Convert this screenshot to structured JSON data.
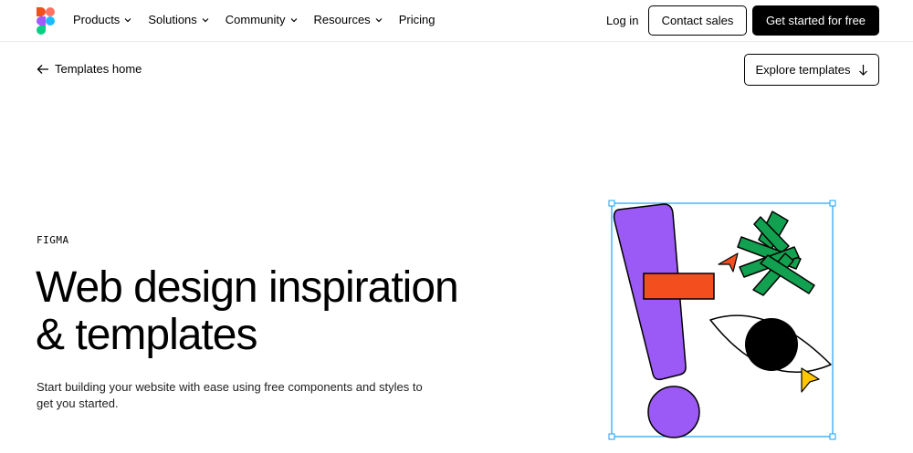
{
  "nav": {
    "menu": [
      {
        "label": "Products",
        "has_dropdown": true
      },
      {
        "label": "Solutions",
        "has_dropdown": true
      },
      {
        "label": "Community",
        "has_dropdown": true
      },
      {
        "label": "Resources",
        "has_dropdown": true
      },
      {
        "label": "Pricing",
        "has_dropdown": false
      }
    ],
    "login": "Log in",
    "contact_sales": "Contact sales",
    "get_started": "Get started for free"
  },
  "subnav": {
    "back_label": "Templates home",
    "explore_label": "Explore templates"
  },
  "hero": {
    "eyebrow": "FIGMA",
    "headline_line1": "Web design inspiration",
    "headline_line2": "& templates",
    "subtext": "Start building your website with ease using free components and styles to get you started."
  },
  "colors": {
    "purple": "#9b59f5",
    "red_orange": "#f24e1e",
    "green": "#12a150",
    "yellow": "#ffc700",
    "selection_blue": "#18a0fb"
  }
}
